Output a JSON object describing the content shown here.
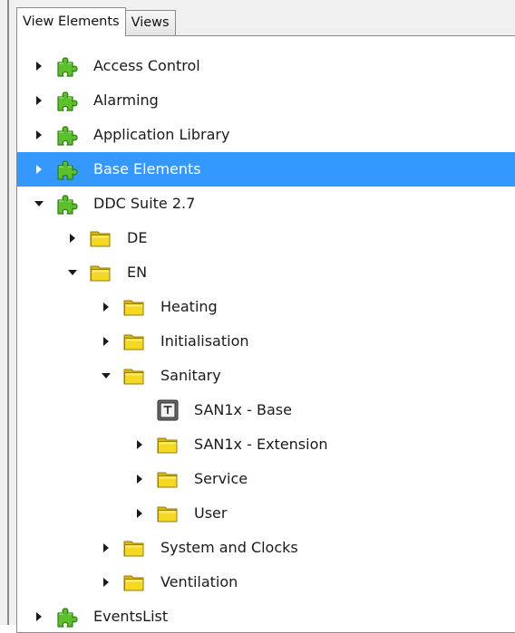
{
  "tabs": [
    {
      "label": "View Elements",
      "active": true
    },
    {
      "label": "Views",
      "active": false
    }
  ],
  "tree": [
    {
      "label": "Access Control",
      "level": 0,
      "icon": "puzzle-icon",
      "expander": "collapsed",
      "selected": false
    },
    {
      "label": "Alarming",
      "level": 0,
      "icon": "puzzle-icon",
      "expander": "collapsed",
      "selected": false
    },
    {
      "label": "Application Library",
      "level": 0,
      "icon": "puzzle-icon",
      "expander": "collapsed",
      "selected": false
    },
    {
      "label": "Base Elements",
      "level": 0,
      "icon": "puzzle-icon",
      "expander": "collapsed",
      "selected": true
    },
    {
      "label": "DDC Suite 2.7",
      "level": 0,
      "icon": "puzzle-icon",
      "expander": "expanded",
      "selected": false
    },
    {
      "label": "DE",
      "level": 1,
      "icon": "folder-icon",
      "expander": "collapsed",
      "selected": false
    },
    {
      "label": "EN",
      "level": 1,
      "icon": "folder-icon",
      "expander": "expanded",
      "selected": false
    },
    {
      "label": "Heating",
      "level": 2,
      "icon": "folder-icon",
      "expander": "collapsed",
      "selected": false
    },
    {
      "label": "Initialisation",
      "level": 2,
      "icon": "folder-icon",
      "expander": "collapsed",
      "selected": false
    },
    {
      "label": "Sanitary",
      "level": 2,
      "icon": "folder-icon",
      "expander": "expanded",
      "selected": false
    },
    {
      "label": "SAN1x - Base",
      "level": 3,
      "icon": "template-icon",
      "expander": "none",
      "selected": false
    },
    {
      "label": "SAN1x - Extension",
      "level": 3,
      "icon": "folder-icon",
      "expander": "collapsed",
      "selected": false
    },
    {
      "label": "Service",
      "level": 3,
      "icon": "folder-icon",
      "expander": "collapsed",
      "selected": false
    },
    {
      "label": "User",
      "level": 3,
      "icon": "folder-icon",
      "expander": "collapsed",
      "selected": false
    },
    {
      "label": "System and Clocks",
      "level": 2,
      "icon": "folder-icon",
      "expander": "collapsed",
      "selected": false
    },
    {
      "label": "Ventilation",
      "level": 2,
      "icon": "folder-icon",
      "expander": "collapsed",
      "selected": false
    },
    {
      "label": "EventsList",
      "level": 0,
      "icon": "puzzle-icon",
      "expander": "collapsed",
      "selected": false
    }
  ],
  "colors": {
    "selection": "#3399ff",
    "puzzle_green": "#5cc02a",
    "folder_yellow": "#f3d21a"
  }
}
